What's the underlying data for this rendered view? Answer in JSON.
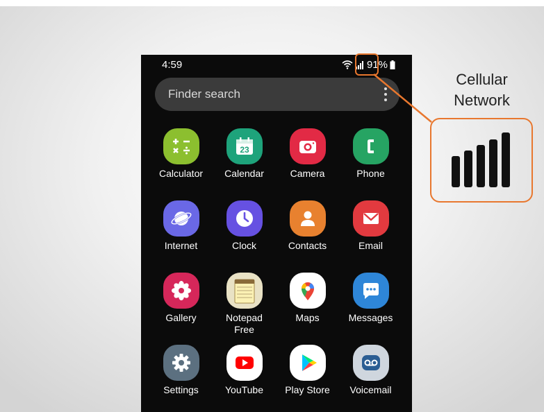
{
  "status_bar": {
    "time": "4:59",
    "battery": "91%"
  },
  "search": {
    "placeholder": "Finder search"
  },
  "apps": [
    {
      "label": "Calculator",
      "icon": "calculator-icon"
    },
    {
      "label": "Calendar",
      "icon": "calendar-icon",
      "badge": "23"
    },
    {
      "label": "Camera",
      "icon": "camera-icon"
    },
    {
      "label": "Phone",
      "icon": "phone-icon"
    },
    {
      "label": "Internet",
      "icon": "internet-icon"
    },
    {
      "label": "Clock",
      "icon": "clock-icon"
    },
    {
      "label": "Contacts",
      "icon": "contacts-icon"
    },
    {
      "label": "Email",
      "icon": "email-icon"
    },
    {
      "label": "Gallery",
      "icon": "gallery-icon"
    },
    {
      "label": "Notepad Free",
      "line1": "Notepad",
      "line2": "Free",
      "icon": "notepad-icon"
    },
    {
      "label": "Maps",
      "icon": "maps-icon"
    },
    {
      "label": "Messages",
      "icon": "messages-icon"
    },
    {
      "label": "Settings",
      "icon": "settings-icon"
    },
    {
      "label": "YouTube",
      "icon": "youtube-icon"
    },
    {
      "label": "Play Store",
      "icon": "play-store-icon"
    },
    {
      "label": "Voicemail",
      "icon": "voicemail-icon"
    }
  ],
  "callout": {
    "line1": "Cellular",
    "line2": "Network",
    "signal_bars": 5
  },
  "colors": {
    "callout": "#e8772e",
    "phone_background": "#0b0b0b",
    "search_bar": "#3b3b3b"
  }
}
